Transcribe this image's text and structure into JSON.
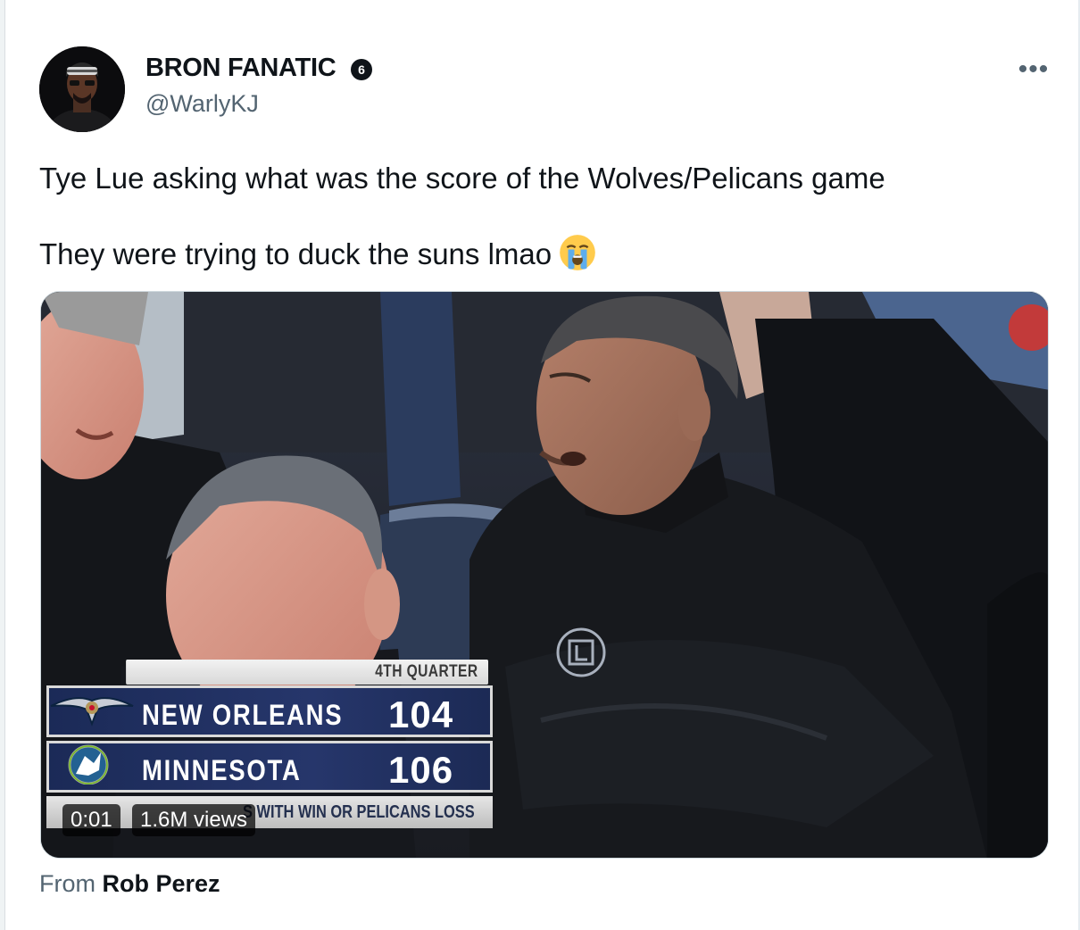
{
  "author": {
    "display_name": "BRON FANATIC",
    "badge": "6",
    "handle": "@WarlyKJ"
  },
  "tweet": {
    "line1": "Tye Lue asking what was the score of the Wolves/Pelicans game",
    "line2": "They were trying to duck the suns lmao",
    "emoji": "loudly-crying-face"
  },
  "media": {
    "scorebug": {
      "quarter": "4TH QUARTER",
      "teams": [
        {
          "name": "NEW ORLEANS",
          "score": "104"
        },
        {
          "name": "MINNESOTA",
          "score": "106"
        }
      ],
      "ticker": "S WITH WIN OR PELICANS LOSS"
    },
    "video_time": "0:01",
    "views": "1.6M views"
  },
  "source": {
    "prefix": "From",
    "name": "Rob Perez"
  },
  "colors": {
    "text": "#0f1419",
    "muted": "#536471",
    "scorebug_navy": "#1b2a57"
  },
  "icons": [
    "more-icon",
    "verified-badge-icon",
    "pelicans-logo-icon",
    "timberwolves-logo-icon",
    "clippers-logo-icon"
  ]
}
